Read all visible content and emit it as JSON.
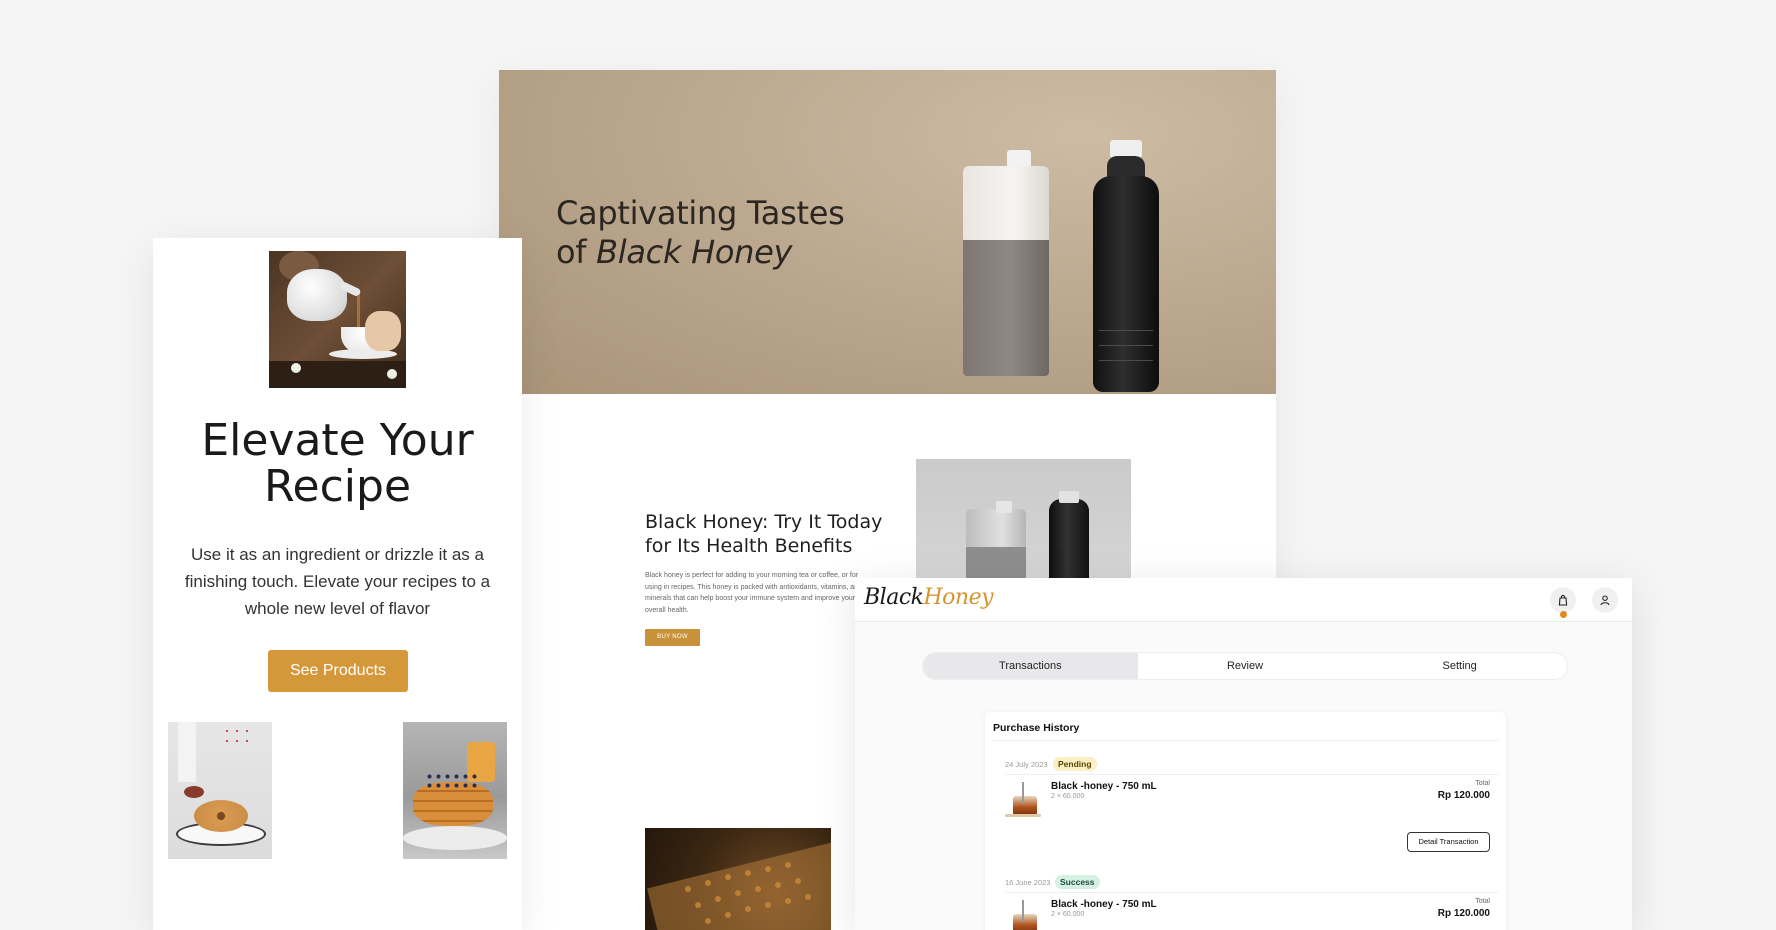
{
  "desktop": {
    "hero": {
      "title_line1": "Captivating Tastes",
      "title_prefix": "of ",
      "title_emphasis": "Black Honey"
    },
    "benefits": {
      "title": "Black Honey: Try It Today for Its Health Benefits",
      "text": "Black honey is perfect for adding to your morning tea or coffee, or for using in recipes. This honey is packed with antioxidants, vitamins, and minerals that can help boost your immune system and improve your overall health.",
      "button_label": "BUY NOW"
    }
  },
  "mobile": {
    "title": "Elevate Your Recipe",
    "text": "Use it as an ingredient or drizzle it as a finishing touch. Elevate your recipes to a whole new level of flavor",
    "button_label": "See Products"
  },
  "app": {
    "brand_black": "Black",
    "brand_honey": "Honey",
    "accent_color": "#d6952e",
    "header_icons": [
      "shopping-bag-icon",
      "user-icon"
    ],
    "tabs": [
      {
        "label": "Transactions",
        "active": true
      },
      {
        "label": "Review",
        "active": false
      },
      {
        "label": "Setting",
        "active": false
      }
    ],
    "history": {
      "title": "Purchase History",
      "transactions": [
        {
          "date": "24 July 2023",
          "status": "Pending",
          "product": "Black -honey - 750 mL",
          "qty": "2 × 60.000",
          "total_label": "Total",
          "total": "Rp 120.000",
          "button_label": "Detail Transaction"
        },
        {
          "date": "16 June 2023",
          "status": "Success",
          "product": "Black -honey - 750 mL",
          "qty": "2 × 60.000",
          "total_label": "Total",
          "total": "Rp 120.000"
        }
      ]
    }
  }
}
